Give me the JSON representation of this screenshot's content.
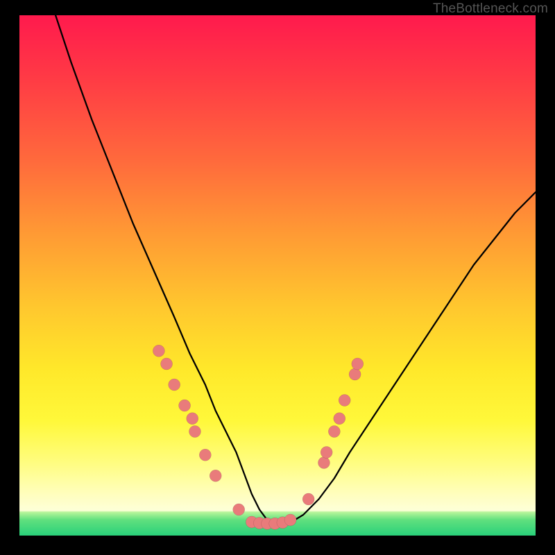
{
  "watermark": "TheBottleneck.com",
  "colors": {
    "dot": "#e97b7b",
    "curve": "#000000",
    "frame": "#000000"
  },
  "chart_data": {
    "type": "line",
    "title": "",
    "xlabel": "",
    "ylabel": "",
    "xlim": [
      0,
      100
    ],
    "ylim": [
      0,
      100
    ],
    "grid": false,
    "legend": false,
    "series": [
      {
        "name": "bottleneck-curve",
        "x": [
          7,
          10,
          14,
          18,
          22,
          26,
          30,
          33,
          36,
          38,
          40,
          42,
          43.5,
          45,
          46.5,
          48,
          49.5,
          51,
          53,
          55,
          58,
          61,
          64,
          68,
          72,
          76,
          80,
          84,
          88,
          92,
          96,
          100
        ],
        "y": [
          100,
          91,
          80,
          70,
          60,
          51,
          42,
          35,
          29,
          24,
          20,
          16,
          12,
          8,
          5,
          3,
          2.3,
          2.3,
          2.8,
          4,
          7,
          11,
          16,
          22,
          28,
          34,
          40,
          46,
          52,
          57,
          62,
          66
        ]
      }
    ],
    "scatter": [
      {
        "name": "left-arm-dots",
        "points": [
          {
            "x": 27.0,
            "y": 35.5
          },
          {
            "x": 28.5,
            "y": 33.0
          },
          {
            "x": 30.0,
            "y": 29.0
          },
          {
            "x": 32.0,
            "y": 25.0
          },
          {
            "x": 33.5,
            "y": 22.5
          },
          {
            "x": 34.0,
            "y": 20.0
          },
          {
            "x": 36.0,
            "y": 15.5
          },
          {
            "x": 38.0,
            "y": 11.5
          },
          {
            "x": 42.5,
            "y": 5.0
          }
        ]
      },
      {
        "name": "valley-dots",
        "points": [
          {
            "x": 45.0,
            "y": 2.6
          },
          {
            "x": 46.5,
            "y": 2.4
          },
          {
            "x": 48.0,
            "y": 2.3
          },
          {
            "x": 49.5,
            "y": 2.3
          },
          {
            "x": 51.0,
            "y": 2.5
          },
          {
            "x": 52.5,
            "y": 3.0
          }
        ]
      },
      {
        "name": "right-arm-dots",
        "points": [
          {
            "x": 56.0,
            "y": 7.0
          },
          {
            "x": 59.0,
            "y": 14.0
          },
          {
            "x": 59.5,
            "y": 16.0
          },
          {
            "x": 61.0,
            "y": 20.0
          },
          {
            "x": 62.0,
            "y": 22.5
          },
          {
            "x": 63.0,
            "y": 26.0
          },
          {
            "x": 65.0,
            "y": 31.0
          },
          {
            "x": 65.5,
            "y": 33.0
          }
        ]
      }
    ]
  }
}
